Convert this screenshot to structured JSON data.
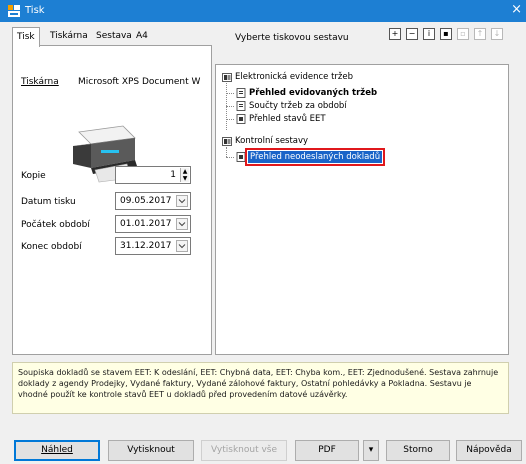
{
  "window": {
    "title": "Tisk",
    "close_glyph": "×"
  },
  "tabs": [
    {
      "label": "Tisk",
      "active": true
    },
    {
      "label": "Tiskárna",
      "active": false
    },
    {
      "label": "Sestava",
      "active": false
    },
    {
      "label": "A4",
      "active": false
    }
  ],
  "left_panel": {
    "printer_label": "Tiskárna",
    "printer_value": "Microsoft XPS Document W",
    "copies_label": "Kopie",
    "copies_value": "1",
    "print_date_label": "Datum tisku",
    "print_date_value": "09.05.2017",
    "period_start_label": "Počátek období",
    "period_start_value": "01.01.2017",
    "period_end_label": "Konec období",
    "period_end_value": "31.12.2017"
  },
  "right_panel": {
    "header": "Vyberte tiskovou sestavu",
    "toolbar_icons": [
      "expand-icon",
      "collapse-icon",
      "info-icon",
      "report-icon",
      "copy-icon",
      "export-icon",
      "import-icon"
    ],
    "tree": [
      {
        "label": "Elektronická evidence tržeb",
        "type": "folder",
        "level": 0
      },
      {
        "label": "Přehled evidovaných tržeb",
        "type": "report",
        "level": 1,
        "bold": true
      },
      {
        "label": "Součty tržeb za období",
        "type": "report",
        "level": 1
      },
      {
        "label": "Přehled stavů EET",
        "type": "report",
        "level": 1
      },
      {
        "label": "Kontrolní sestavy",
        "type": "folder",
        "level": 0
      },
      {
        "label": "Přehled neodeslaných dokladů",
        "type": "report",
        "level": 1,
        "selected": true
      }
    ]
  },
  "description": "Soupiska dokladů se stavem EET: K odeslání, EET: Chybná data, EET: Chyba kom., EET: Zjednodušené. Sestava zahrnuje doklady z agendy Prodejky, Vydané faktury, Vydané zálohové faktury, Ostatní pohledávky a Pokladna. Sestavu je vhodné použít ke kontrole stavů EET u dokladů před provedením datové uzávěrky.",
  "buttons": {
    "preview": "Náhled",
    "print": "Vytisknout",
    "print_all": "Vytisknout vše",
    "pdf": "PDF",
    "pdf_dropdown": "▾",
    "cancel": "Storno",
    "help": "Nápověda"
  },
  "colors": {
    "titlebar": "#1d7fd3",
    "selection": "#1a64c8",
    "highlight_border": "#e0181c",
    "description_bg": "#ffffe4"
  }
}
